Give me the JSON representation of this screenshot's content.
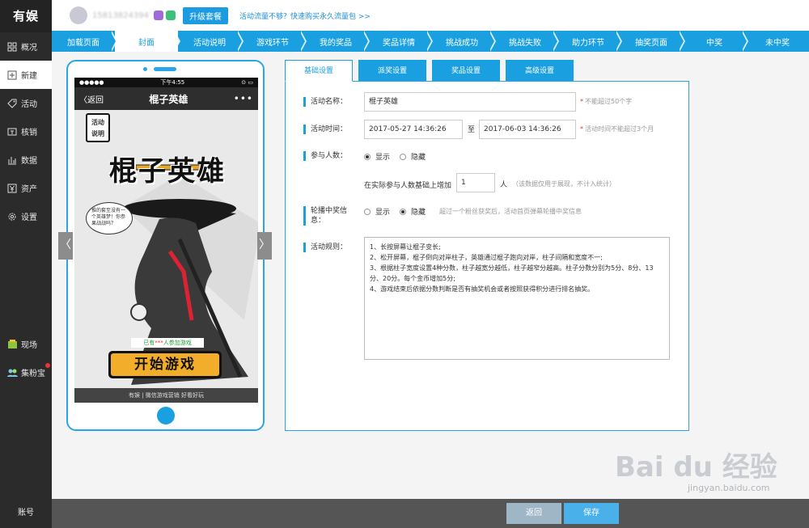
{
  "app": {
    "logo": "有娱"
  },
  "sidebar": {
    "items": [
      {
        "label": "概况",
        "icon": "grid-icon"
      },
      {
        "label": "新建",
        "icon": "plus-square-icon"
      },
      {
        "label": "活动",
        "icon": "tag-icon"
      },
      {
        "label": "核销",
        "icon": "ticket-icon"
      },
      {
        "label": "数据",
        "icon": "bar-chart-icon"
      },
      {
        "label": "资产",
        "icon": "yen-icon"
      },
      {
        "label": "设置",
        "icon": "gear-icon"
      }
    ],
    "extra": [
      {
        "label": "现场",
        "icon": "present-icon"
      },
      {
        "label": "集粉宝",
        "icon": "people-icon"
      }
    ],
    "account": "账号"
  },
  "topbar": {
    "username": "15813824394",
    "upgrade_label": "升级套餐",
    "promo_text": "活动流量不够？快速购买永久流量包 >>"
  },
  "steps": [
    "加载页面",
    "封面",
    "活动说明",
    "游戏环节",
    "我的奖品",
    "奖品详情",
    "挑战成功",
    "挑战失败",
    "助力环节",
    "抽奖页面",
    "中奖",
    "未中奖"
  ],
  "preview": {
    "status_left": "●●●●●",
    "status_time": "下午4:55",
    "status_right": "⊙ ▭",
    "back_label": "返回",
    "nav_title": "棍子英雄",
    "more": "•••",
    "rule_tab": [
      "活动",
      "说明"
    ],
    "game_title": "棍子英雄",
    "bubble_text": "推的套至没有一个英雄梦！你参果战战吗？",
    "joined_prefix": "已有",
    "joined_stars": "***",
    "joined_suffix": "人参加游戏",
    "start_label": "开始游戏",
    "footer_text": "有娱 | 微信游戏营销 好看好玩",
    "prev_arrow": "〈",
    "next_arrow": "〉"
  },
  "tabs": [
    "基础设置",
    "派奖设置",
    "奖品设置",
    "高级设置"
  ],
  "form": {
    "name_label": "活动名称：",
    "name_value": "棍子英雄",
    "name_hint": "不能超过50个字",
    "time_label": "活动时间：",
    "time_start": "2017-05-27 14:36:26",
    "time_sep": "至",
    "time_end": "2017-06-03 14:36:26",
    "time_hint": "活动时间不能超过3个月",
    "participants_label": "参与人数：",
    "show_label": "显示",
    "hide_label": "隐藏",
    "increase_prefix": "在实际参与人数基础上增加",
    "increase_value": "1",
    "increase_unit": "人",
    "increase_hint": "（该数据仅用于展现，不计入统计）",
    "carousel_label_1": "轮播中奖信",
    "carousel_label_2": "息：",
    "carousel_hint": "超过一个粉丝获奖后，活动首页弹幕轮播中奖信息",
    "rules_label": "活动规则：",
    "rules": [
      "1、长按屏幕让棍子变长;",
      "2、松开屏幕，棍子倒向对岸柱子，英雄通过棍子跑向对岸，柱子间隔和宽度不一;",
      "3、根据柱子宽度设置4种分数，柱子越宽分越低，柱子越窄分越高。柱子分数分别为5分、8分、13分、20分。每个金币增加5分;",
      "4、游戏结束后依据分数判断是否有抽奖机会或者按照获得积分进行排名抽奖。"
    ]
  },
  "bottom": {
    "back_label": "返回",
    "save_label": "保存"
  },
  "watermark": {
    "main": "Bai du 经验",
    "sub": "jingyan.baidu.com"
  },
  "colors": {
    "accent": "#1aa0e0",
    "sidebar": "#2b2b2b",
    "required": "#e33333"
  }
}
